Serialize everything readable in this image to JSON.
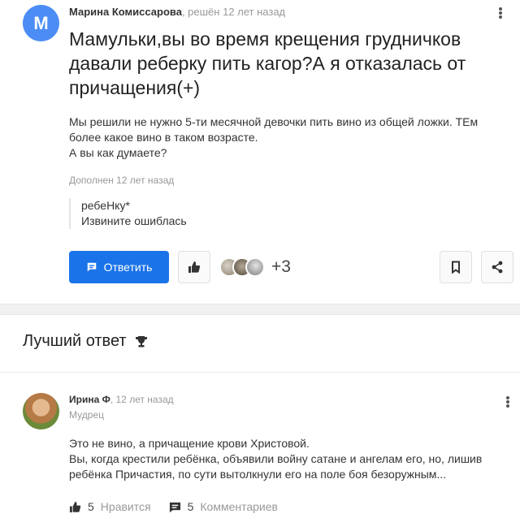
{
  "question": {
    "avatar_letter": "М",
    "author": "Марина Комиссарова",
    "meta_suffix": ", решён 12 лет назад",
    "title": "Мамульки,вы во время крещения грудничков давали реберку пить кагор?А я отказалась от причащения(+)",
    "body": "Мы решили не нужно 5-ти месячной девочки пить вино из общей ложки. ТЕм более какое вино в таком возрасте.\nА вы как думаете?",
    "added_label": "Дополнен 12 лет назад",
    "addition": "ребеНку*\nИзвините ошиблась",
    "reply_label": "Ответить",
    "likers_extra": "+3"
  },
  "best_answer": {
    "heading": "Лучший ответ",
    "author": "Ирина Ф",
    "meta_suffix": ", 12 лет назад",
    "rank": "Мудрец",
    "body_lines": [
      "Это не вино, а причащение крови Христовой.",
      "Вы, когда крестили ребёнка, объявили войну сатане и ангелам его, но, лишив ребёнка Причастия, по сути вытолкнули его на поле боя безоружным..."
    ],
    "likes_count": "5",
    "likes_label": "Нравится",
    "comments_count": "5",
    "comments_label": "Комментариев"
  },
  "colors": {
    "primary_button": "#1a73e8",
    "avatar_question": "#4c8cf5"
  },
  "icons": [
    "kebab-menu-icon",
    "comment-icon",
    "thumbs-up-icon",
    "bookmark-icon",
    "share-icon",
    "trophy-icon"
  ]
}
